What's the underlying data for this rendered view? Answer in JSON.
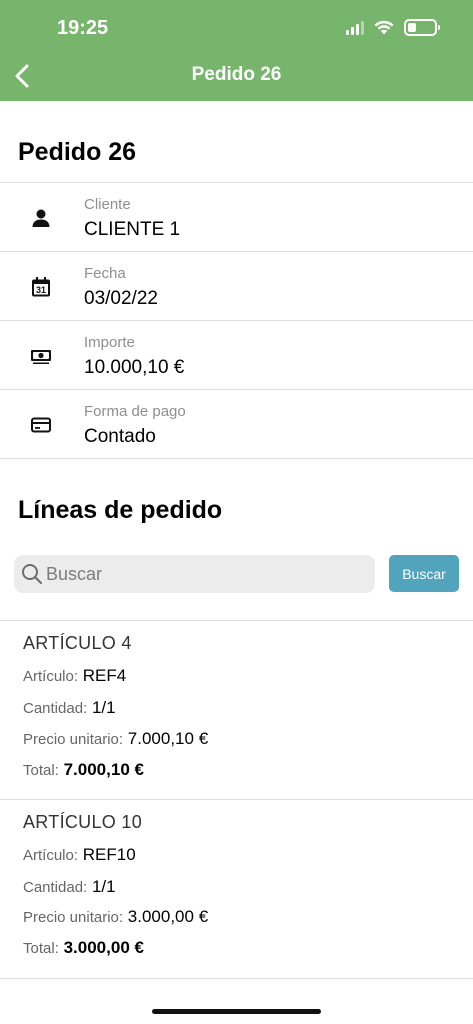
{
  "status": {
    "time": "19:25"
  },
  "nav": {
    "title": "Pedido 26"
  },
  "order": {
    "title": "Pedido 26",
    "fields": [
      {
        "label": "Cliente",
        "value": "CLIENTE 1",
        "icon": "person-icon"
      },
      {
        "label": "Fecha",
        "value": "03/02/22",
        "icon": "calendar-icon"
      },
      {
        "label": "Importe",
        "value": "10.000,10 €",
        "icon": "money-icon"
      },
      {
        "label": "Forma de pago",
        "value": "Contado",
        "icon": "credit-card-icon"
      }
    ],
    "calendar_day": "31"
  },
  "lines": {
    "title": "Líneas de pedido",
    "search_placeholder": "Buscar",
    "search_button": "Buscar",
    "labels": {
      "article": "Artículo:",
      "quantity": "Cantidad:",
      "unit_price": "Precio unitario:",
      "total": "Total:"
    },
    "items": [
      {
        "name": "ARTÍCULO 4",
        "ref": "REF4",
        "quantity": "1/1",
        "unit_price": "7.000,10 €",
        "total": "7.000,10 €"
      },
      {
        "name": "ARTÍCULO 10",
        "ref": "REF10",
        "quantity": "1/1",
        "unit_price": "3.000,00 €",
        "total": "3.000,00 €"
      }
    ]
  },
  "colors": {
    "header": "#77b56c",
    "search_button": "#52a4bd"
  }
}
